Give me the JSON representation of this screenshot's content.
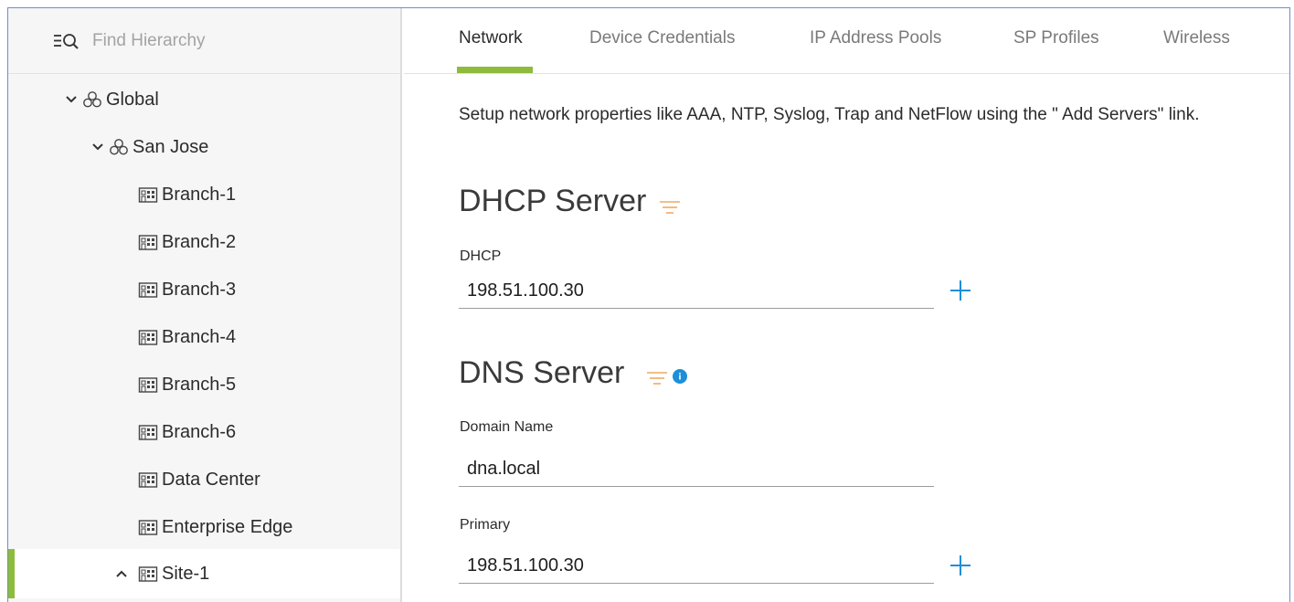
{
  "sidebar": {
    "search_placeholder": "Find Hierarchy",
    "search_icon": "filter-search-icon",
    "tree": [
      {
        "label": "Global",
        "icon": "area-icon",
        "expanded": true
      },
      {
        "label": "San Jose",
        "icon": "area-icon",
        "expanded": true
      },
      {
        "label": "Branch-1",
        "icon": "building-icon"
      },
      {
        "label": "Branch-2",
        "icon": "building-icon"
      },
      {
        "label": "Branch-3",
        "icon": "building-icon"
      },
      {
        "label": "Branch-4",
        "icon": "building-icon"
      },
      {
        "label": "Branch-5",
        "icon": "building-icon"
      },
      {
        "label": "Branch-6",
        "icon": "building-icon"
      },
      {
        "label": "Data Center",
        "icon": "building-icon"
      },
      {
        "label": "Enterprise Edge",
        "icon": "building-icon"
      },
      {
        "label": "Site-1",
        "icon": "building-icon",
        "expanded": false,
        "selected": true
      }
    ]
  },
  "tabs": [
    {
      "label": "Network",
      "active": true
    },
    {
      "label": "Device Credentials"
    },
    {
      "label": "IP Address Pools"
    },
    {
      "label": "SP Profiles"
    },
    {
      "label": "Wireless"
    }
  ],
  "description": "Setup network properties like AAA, NTP, Syslog, Trap and NetFlow using the \" Add Servers\"  link.",
  "dhcp": {
    "title": "DHCP Server",
    "label": "DHCP",
    "value": "198.51.100.30"
  },
  "dns": {
    "title": "DNS Server",
    "domain_label": "Domain Name",
    "domain_value": "dna.local",
    "primary_label": "Primary",
    "primary_value": "198.51.100.30"
  },
  "colors": {
    "accent_green": "#8dbb3b",
    "filter_orange": "#f0a860",
    "plus_blue": "#1d8fd8",
    "info_blue": "#1d8fd8"
  }
}
